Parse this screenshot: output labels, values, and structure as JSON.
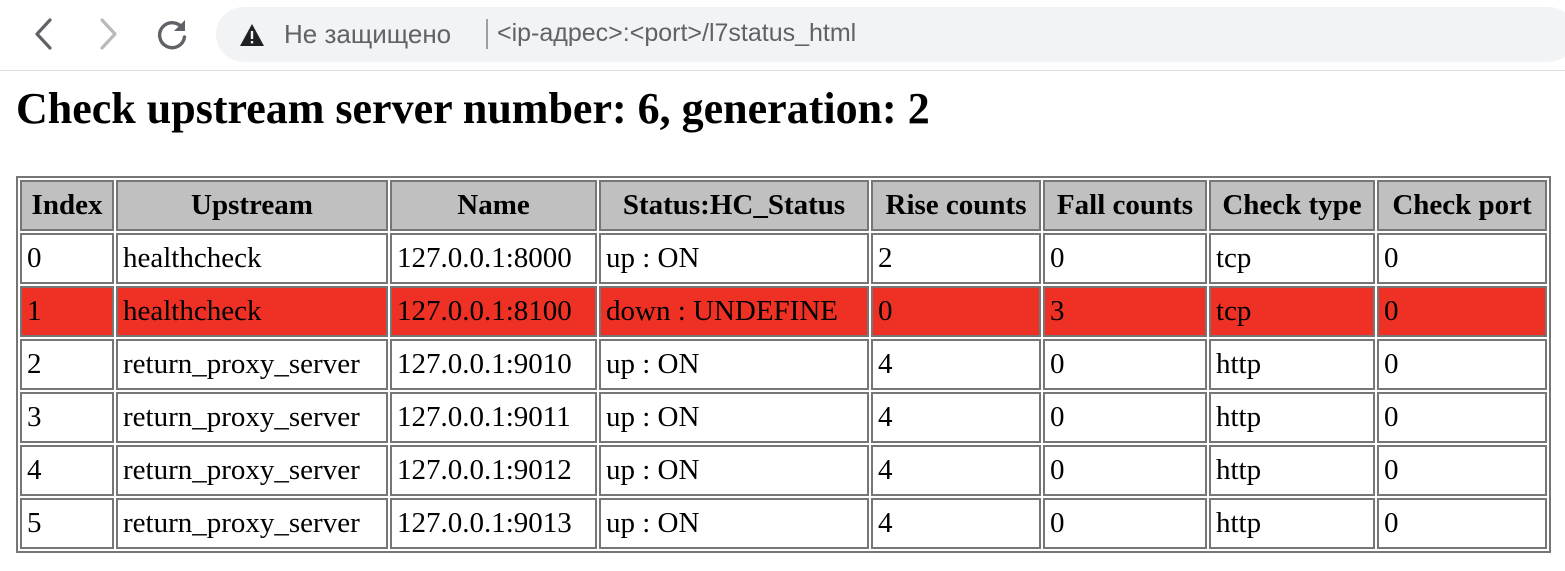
{
  "browser": {
    "security_label": "Не защищено",
    "url": "<ip-адрес>:<port>/l7status_html",
    "icons": {
      "back": "back-arrow-icon",
      "forward": "forward-arrow-icon",
      "reload": "reload-icon",
      "security": "warning-triangle-icon"
    }
  },
  "page": {
    "title": "Check upstream server number: 6, generation: 2"
  },
  "table": {
    "headers": [
      "Index",
      "Upstream",
      "Name",
      "Status:HC_Status",
      "Rise counts",
      "Fall counts",
      "Check type",
      "Check port"
    ],
    "rows": [
      [
        "0",
        "healthcheck",
        "127.0.0.1:8000",
        "up : ON",
        "2",
        "0",
        "tcp",
        "0"
      ],
      [
        "1",
        "healthcheck",
        "127.0.0.1:8100",
        "down : UNDEFINE",
        "0",
        "3",
        "tcp",
        "0"
      ],
      [
        "2",
        "return_proxy_server",
        "127.0.0.1:9010",
        "up : ON",
        "4",
        "0",
        "http",
        "0"
      ],
      [
        "3",
        "return_proxy_server",
        "127.0.0.1:9011",
        "up : ON",
        "4",
        "0",
        "http",
        "0"
      ],
      [
        "4",
        "return_proxy_server",
        "127.0.0.1:9012",
        "up : ON",
        "4",
        "0",
        "http",
        "0"
      ],
      [
        "5",
        "return_proxy_server",
        "127.0.0.1:9013",
        "up : ON",
        "4",
        "0",
        "http",
        "0"
      ]
    ],
    "colors": {
      "header_bg": "#c0c0c0",
      "down_row_bg": "#ee3124",
      "border": "#767676"
    }
  }
}
